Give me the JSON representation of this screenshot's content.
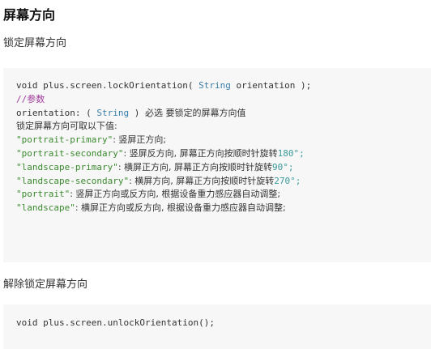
{
  "heading": "屏幕方向",
  "lock_label": "锁定屏幕方向",
  "unlock_label": "解除锁定屏幕方向",
  "lock_code": {
    "signature": {
      "prefix": "void plus.screen.lockOrientation( ",
      "type": "String",
      "suffix": " orientation );"
    },
    "comment": "//参数",
    "param": {
      "name": "orientation: ( ",
      "type": "String",
      "mid": " ) ",
      "desc": "必选 要锁定的屏幕方向值"
    },
    "values_intro": "锁定屏幕方向可取以下值:",
    "values": [
      {
        "key": "\"portrait-primary\"",
        "desc": ": 竖屏正方向;",
        "num": ""
      },
      {
        "key": "\"portrait-secondary\"",
        "desc": ": 竖屏反方向, 屏幕正方向按顺时针旋转",
        "num": "180°;"
      },
      {
        "key": "\"landscape-primary\"",
        "desc": ": 横屏正方向, 屏幕正方向按顺时针旋转",
        "num": "90°;"
      },
      {
        "key": "\"landscape-secondary\"",
        "desc": ": 横屏方向, 屏幕正方向按顺时针旋转",
        "num": "270°;"
      },
      {
        "key": "\"portrait\"",
        "desc": ": 竖屏正方向或反方向, 根据设备重力感应器自动调整;",
        "num": ""
      },
      {
        "key": "\"landscape\"",
        "desc": ": 横屏正方向或反方向, 根据设备重力感应器自动调整;",
        "num": ""
      }
    ]
  },
  "unlock_code": {
    "line": "void plus.screen.unlockOrientation();"
  }
}
